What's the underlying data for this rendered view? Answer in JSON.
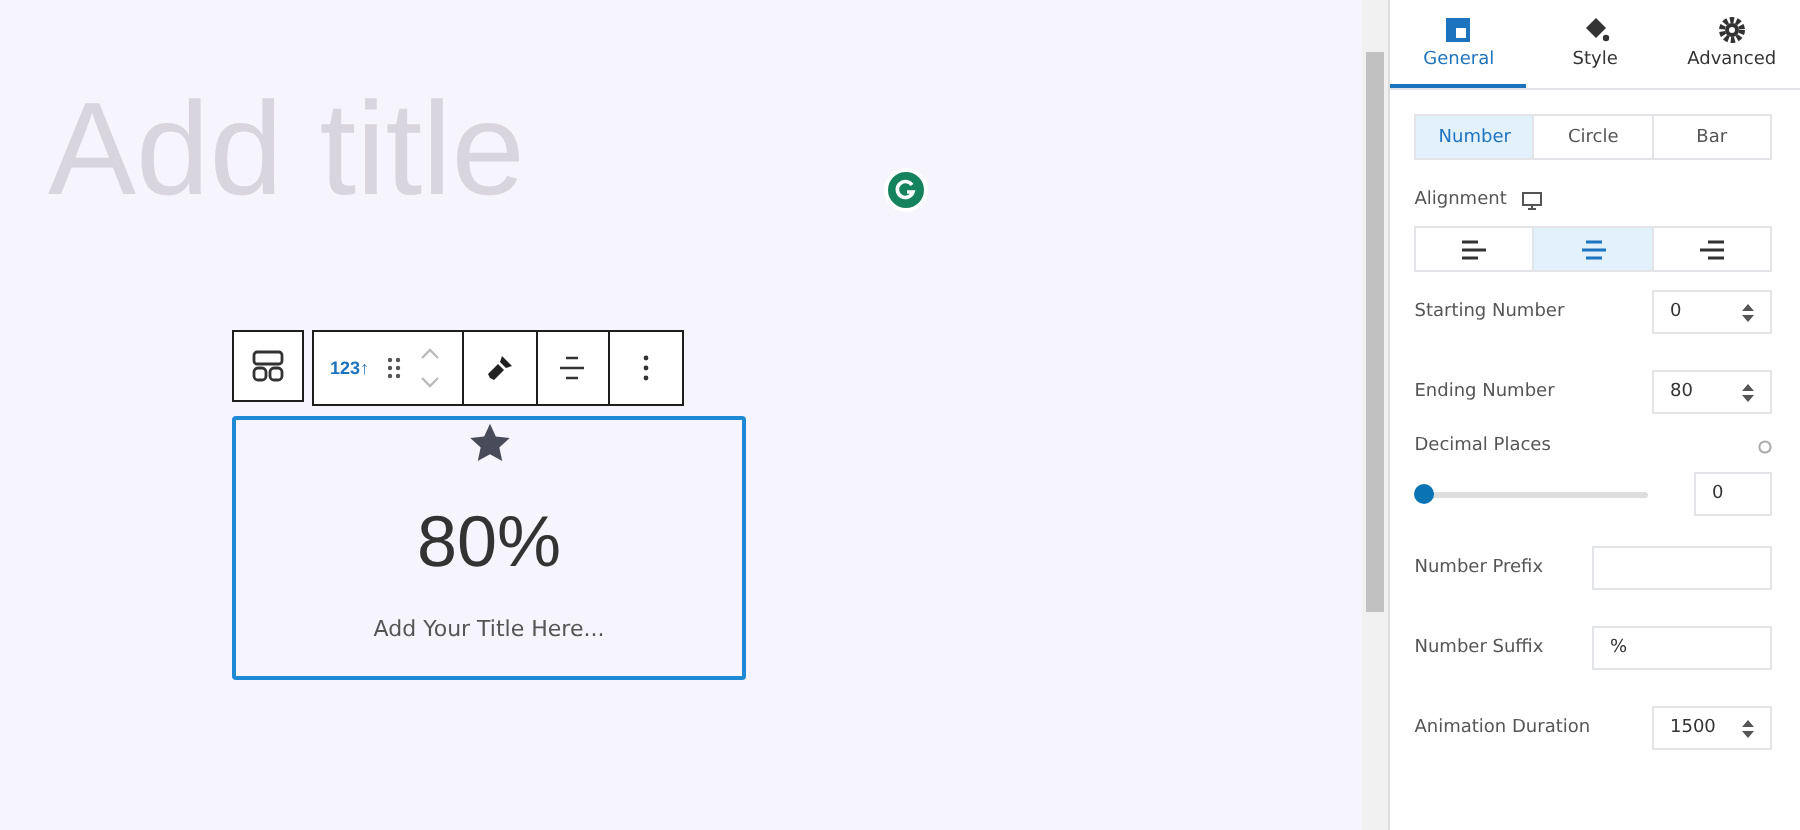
{
  "editor": {
    "title_placeholder": "Add title",
    "block_type_label": "123↑",
    "block": {
      "value": "80%",
      "title_placeholder": "Add Your Title Here..."
    }
  },
  "sidebar": {
    "tabs": [
      {
        "label": "General",
        "selected": true
      },
      {
        "label": "Style",
        "selected": false
      },
      {
        "label": "Advanced",
        "selected": false
      }
    ],
    "layouts": [
      {
        "label": "Number",
        "selected": true
      },
      {
        "label": "Circle",
        "selected": false
      },
      {
        "label": "Bar",
        "selected": false
      }
    ],
    "alignment_label": "Alignment",
    "alignments": [
      {
        "kind": "left",
        "selected": false
      },
      {
        "kind": "center",
        "selected": true
      },
      {
        "kind": "right",
        "selected": false
      }
    ],
    "fields": [
      {
        "kind": "number",
        "label": "Starting Number",
        "value": "0"
      },
      {
        "kind": "number",
        "label": "Ending Number",
        "value": "80"
      },
      {
        "kind": "slider",
        "label": "Decimal Places",
        "level": 0,
        "value": "0"
      },
      {
        "kind": "text",
        "label": "Number Prefix"
      },
      {
        "kind": "text",
        "label": "Number Suffix",
        "value": "%"
      },
      {
        "kind": "number",
        "label": "Animation Duration",
        "value": "1500"
      }
    ]
  }
}
